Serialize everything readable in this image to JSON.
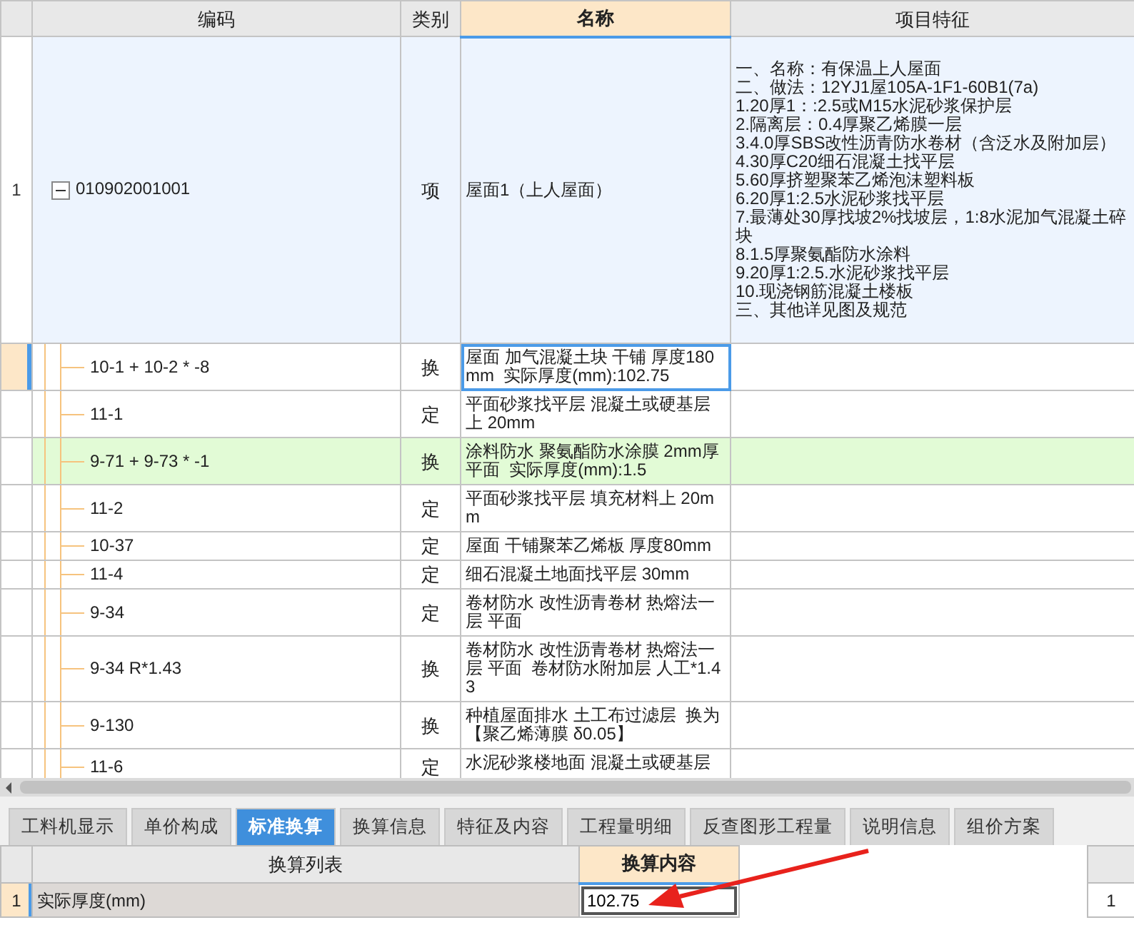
{
  "grid": {
    "columns": [
      {
        "label": "编码",
        "active": false
      },
      {
        "label": "类别",
        "active": false
      },
      {
        "label": "名称",
        "active": true
      },
      {
        "label": "项目特征",
        "active": false
      }
    ],
    "rows": [
      {
        "number": "1",
        "code": "010902001001",
        "type": "项",
        "name": "屋面1（上人屋面）",
        "expanded": true,
        "features": [
          "一、名称：有保温上人屋面",
          "二、做法：12YJ1屋105A-1F1-60B1(7a)",
          "1.20厚1：:2.5或M15水泥砂浆保护层",
          "2.隔离层：0.4厚聚乙烯膜一层",
          "3.4.0厚SBS改性沥青防水卷材（含泛水及附加层）",
          "4.30厚C20细石混凝土找平层",
          "5.60厚挤塑聚苯乙烯泡沫塑料板",
          "6.20厚1:2.5水泥砂浆找平层",
          "7.最薄处30厚找坡2%找坡层，1:8水泥加气混凝土碎块",
          "8.1.5厚聚氨酯防水涂料",
          "9.20厚1:2.5.水泥砂浆找平层",
          "10.现浇钢筋混凝土楼板",
          "三、其他详见图及规范"
        ],
        "children": [
          {
            "code": "10-1 + 10-2 * -8",
            "type": "换",
            "name": "屋面 加气混凝土块 干铺 厚度180mm  实际厚度(mm):102.75",
            "selected": true,
            "highlighted": false
          },
          {
            "code": "11-1",
            "type": "定",
            "name": "平面砂浆找平层 混凝土或硬基层上 20mm",
            "selected": false,
            "highlighted": false
          },
          {
            "code": "9-71 + 9-73 * -1",
            "type": "换",
            "name": "涂料防水 聚氨酯防水涂膜 2mm厚平面  实际厚度(mm):1.5",
            "selected": false,
            "highlighted": true
          },
          {
            "code": "11-2",
            "type": "定",
            "name": "平面砂浆找平层 填充材料上 20mm",
            "selected": false,
            "highlighted": false
          },
          {
            "code": "10-37",
            "type": "定",
            "name": "屋面 干铺聚苯乙烯板 厚度80mm",
            "selected": false,
            "highlighted": false
          },
          {
            "code": "11-4",
            "type": "定",
            "name": "细石混凝土地面找平层 30mm",
            "selected": false,
            "highlighted": false
          },
          {
            "code": "9-34",
            "type": "定",
            "name": "卷材防水 改性沥青卷材 热熔法一层 平面",
            "selected": false,
            "highlighted": false
          },
          {
            "code": "9-34 R*1.43",
            "type": "换",
            "name": "卷材防水 改性沥青卷材 热熔法一层 平面  卷材防水附加层 人工*1.43",
            "selected": false,
            "highlighted": false
          },
          {
            "code": "9-130",
            "type": "换",
            "name": "种植屋面排水 土工布过滤层  换为【聚乙烯薄膜 δ0.05】",
            "selected": false,
            "highlighted": false
          },
          {
            "code": "11-6",
            "type": "定",
            "name": "水泥砂浆楼地面 混凝土或硬基层",
            "selected": false,
            "highlighted": false
          }
        ]
      }
    ]
  },
  "tabs": [
    {
      "label": "工料机显示",
      "selected": false
    },
    {
      "label": "单价构成",
      "selected": false
    },
    {
      "label": "标准换算",
      "selected": true
    },
    {
      "label": "换算信息",
      "selected": false
    },
    {
      "label": "特征及内容",
      "selected": false
    },
    {
      "label": "工程量明细",
      "selected": false
    },
    {
      "label": "反查图形工程量",
      "selected": false
    },
    {
      "label": "说明信息",
      "selected": false
    },
    {
      "label": "组价方案",
      "selected": false
    }
  ],
  "conversion": {
    "columns": [
      {
        "label": "换算列表",
        "active": false
      },
      {
        "label": "换算内容",
        "active": true
      }
    ],
    "rows": [
      {
        "number": "1",
        "item": "实际厚度(mm)",
        "value": "102.75"
      }
    ]
  },
  "side_panel": {
    "rows": [
      {
        "number": "1"
      }
    ]
  }
}
